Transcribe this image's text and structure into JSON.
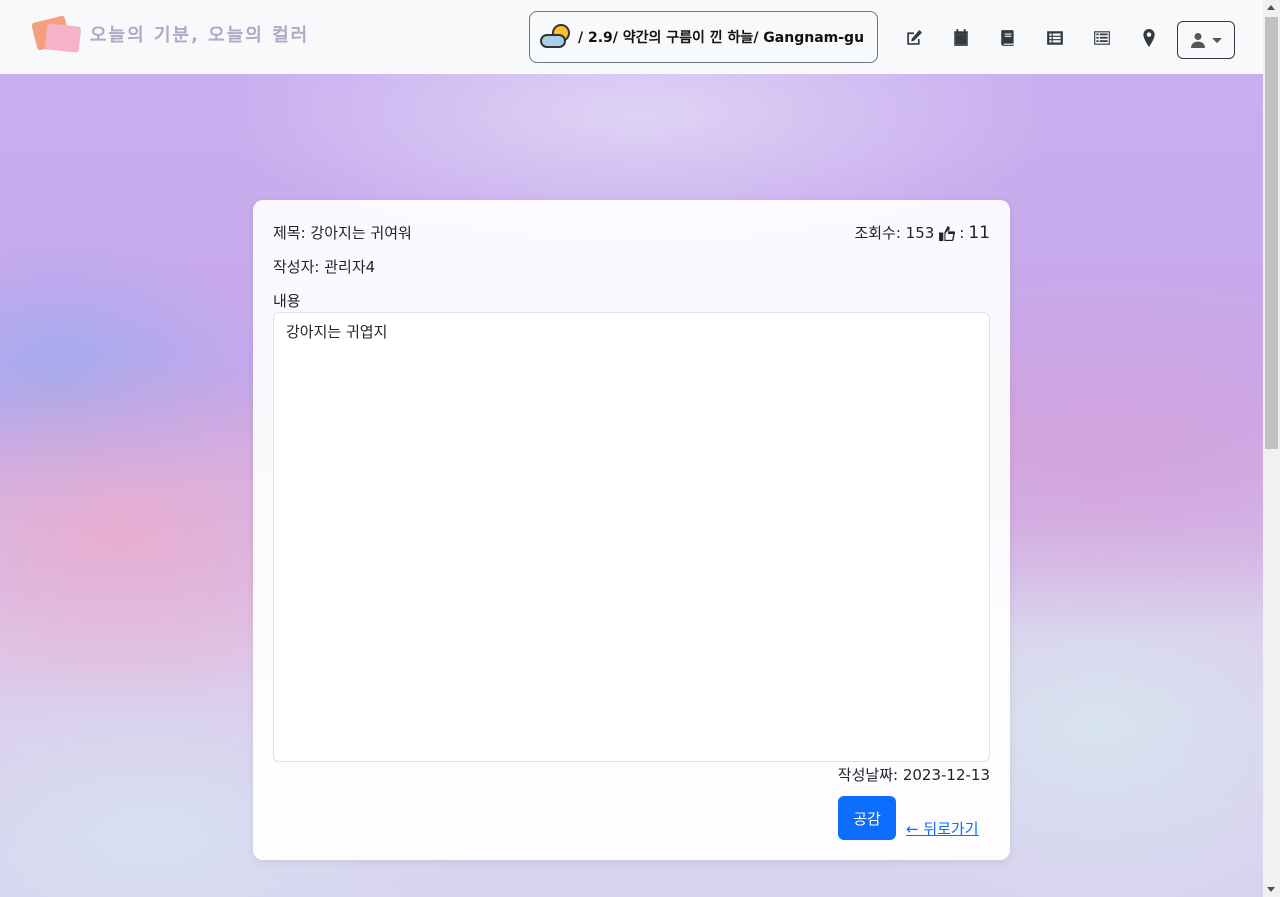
{
  "header": {
    "brand_text": "오늘의 기분, 오늘의 컬러",
    "weather_text": "/ 2.9/ 약간의 구름이 낀 하늘/ Gangnam-gu",
    "nav_icons": [
      "edit-icon",
      "calendar-icon",
      "book-icon",
      "list-alt-icon",
      "list-icon",
      "map-marker-icon"
    ],
    "user_icon": "user-icon"
  },
  "post": {
    "title_label": "제목: 강아지는 귀여워",
    "views_label": "조회수: 153",
    "likes_sep": ":",
    "likes_count": "11",
    "author_label": "작성자: 관리자4",
    "content_label": "내용",
    "content": "강아지는 귀엽지",
    "date_label": "작성날짜: 2023-12-13",
    "like_button": "공감",
    "back_link": "← 뒤로가기"
  },
  "colors": {
    "primary": "#0d6efd",
    "navbar_bg": "#f8f9fa"
  }
}
